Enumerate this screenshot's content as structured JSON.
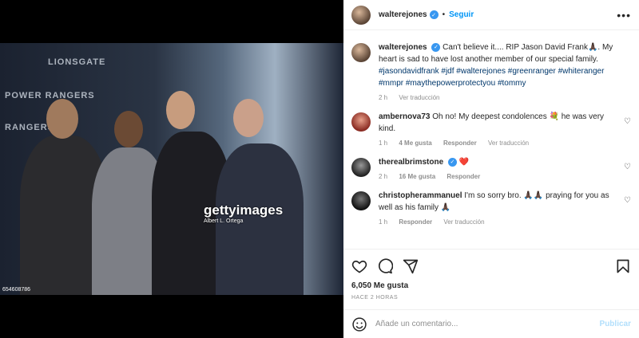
{
  "photo": {
    "backdrop_texts": [
      "LIONSGATE",
      "POWER RANGERS",
      "RANGERS"
    ],
    "watermark_logo": "gettyimages",
    "watermark_credit": "Albert L. Ortega",
    "photo_id": "654608786"
  },
  "header": {
    "username": "walterejones",
    "separator": "•",
    "follow_label": "Seguir",
    "more_label": "•••"
  },
  "caption": {
    "username": "walterejones",
    "text": "Can't believe it.... RIP Jason David Frank🙏🏿. My heart is sad to have lost another member of our special family.",
    "hashtags": "#jasondavidfrank #jdf #walterejones #greenranger #whiteranger #mmpr #maythepowerprotectyou #tommy",
    "time": "2 h",
    "translate": "Ver traducción"
  },
  "comments": [
    {
      "username": "ambernova73",
      "text": "Oh no! My deepest condolences 💐 he was very kind.",
      "time": "1 h",
      "likes": "4 Me gusta",
      "reply": "Responder",
      "translate": "Ver traducción"
    },
    {
      "username": "therealbrimstone",
      "text": "❤️",
      "time": "2 h",
      "likes": "16 Me gusta",
      "reply": "Responder"
    },
    {
      "username": "christopherammanuel",
      "text": "I'm so sorry bro. 🙏🏿🙏🏿 praying for you as well as his family 🙏🏿",
      "time": "1 h",
      "reply": "Responder",
      "translate": "Ver traducción"
    }
  ],
  "actions": {
    "likes": "6,050 Me gusta",
    "timestamp": "HACE 2 HORAS"
  },
  "add_comment": {
    "placeholder": "Añade un comentario...",
    "publish_label": "Publicar"
  },
  "icons": [
    "heart-icon",
    "comment-icon",
    "share-icon",
    "bookmark-icon",
    "emoji-icon",
    "more-icon",
    "verified-icon"
  ],
  "colors": {
    "link_blue": "#0095f6",
    "hashtag_blue": "#00376b",
    "verified_blue": "#3897f0",
    "muted_gray": "#8e8e8e",
    "publish_disabled": "#b2dffc"
  }
}
